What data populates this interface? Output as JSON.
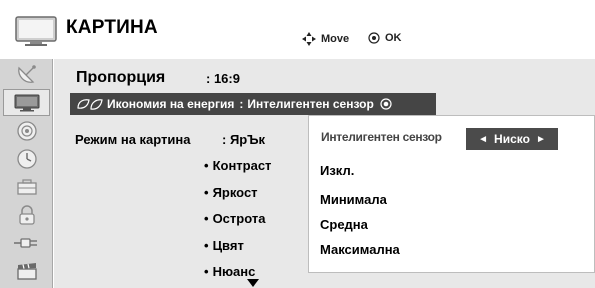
{
  "header": {
    "title": "КАРТИНА",
    "move_label": "Move",
    "ok_label": "OK"
  },
  "sidebar": {
    "items": [
      {
        "icon": "satellite-dish-icon"
      },
      {
        "icon": "picture-tv-icon",
        "active": true
      },
      {
        "icon": "audio-speaker-icon"
      },
      {
        "icon": "clock-icon"
      },
      {
        "icon": "settings-toolbox-icon"
      },
      {
        "icon": "lock-icon"
      },
      {
        "icon": "input-plug-icon"
      },
      {
        "icon": "media-clapper-icon"
      }
    ]
  },
  "picture": {
    "ratio_label": "Пропорция",
    "ratio_value": ": 16:9",
    "energy_label": "Икономия на енергия",
    "energy_sep": ":",
    "energy_value": "Интелигентен сензор",
    "mode_label": "Режим на картина",
    "mode_value": ": ЯрЪк",
    "bullet": "•",
    "sub_items": [
      "Контраст",
      "Яркост",
      "Острота",
      "Цвят",
      "Нюанс"
    ]
  },
  "popup": {
    "title": "Интелигентен сензор",
    "selected_value": "Ниско",
    "left_arrow": "◄",
    "right_arrow": "►",
    "options": [
      "Изкл.",
      "Минимала",
      "Средна",
      "Максимална"
    ]
  },
  "colors": {
    "highlight": "#454545",
    "sidebar": "#d4d4d4",
    "content": "#e8e8e8"
  }
}
